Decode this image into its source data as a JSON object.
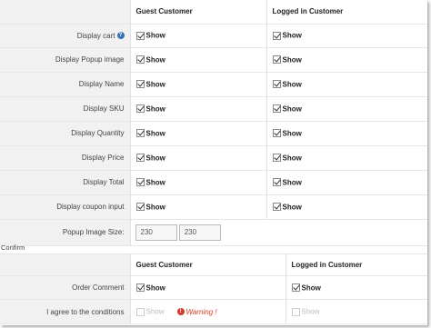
{
  "display_table": {
    "headers": {
      "guest": "Guest Customer",
      "logged": "Logged in Customer"
    },
    "rows": [
      {
        "label": "Display cart",
        "guest": "Show",
        "logged": "Show"
      },
      {
        "label": "Display Popup image",
        "guest": "Show",
        "logged": "Show"
      },
      {
        "label": "Display Name",
        "guest": "Show",
        "logged": "Show"
      },
      {
        "label": "Display SKU",
        "guest": "Show",
        "logged": "Show"
      },
      {
        "label": "Display Quantity",
        "guest": "Show",
        "logged": "Show"
      },
      {
        "label": "Display Price",
        "guest": "Show",
        "logged": "Show"
      },
      {
        "label": "Display Total",
        "guest": "Show",
        "logged": "Show"
      },
      {
        "label": "Display coupon input",
        "guest": "Show",
        "logged": "Show"
      }
    ],
    "help_icon": "question-icon",
    "popup_size": {
      "label": "Popup Image Size:",
      "width": "230",
      "height": "230"
    }
  },
  "confirm": {
    "section_label": "Confirm",
    "headers": {
      "guest": "Guest Customer",
      "logged": "Logged in Customer"
    },
    "order_comment": {
      "label": "Order Comment",
      "guest": "Show",
      "logged": "Show"
    },
    "agree": {
      "label": "I agree to the conditions",
      "guest": "Show",
      "warning": "Warning !",
      "logged": "Show"
    }
  },
  "colors": {
    "label_bg": "#f1f1f1",
    "help": "#3a6fb5",
    "warning": "#d43a2a"
  }
}
